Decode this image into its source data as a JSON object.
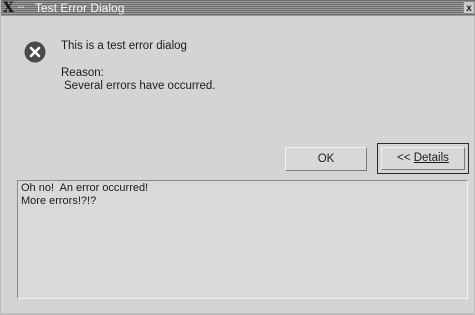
{
  "window": {
    "title": "Test Error Dialog",
    "close_glyph": "x",
    "menu_glyph": "--",
    "logo_glyph": "X"
  },
  "message": {
    "headline": "This is a test error dialog",
    "reason_label": "Reason:",
    "reason_text": "Several errors have occurred."
  },
  "buttons": {
    "ok_label": "OK",
    "details_prefix": "<< ",
    "details_label": "Details"
  },
  "details": {
    "lines": [
      "Oh no!  An error occurred!",
      "More errors!?!?"
    ]
  },
  "icons": {
    "error": "error-x-circle-icon"
  },
  "colors": {
    "titlebar_dark": "#6d6d6d",
    "titlebar_light": "#9a9a9a",
    "dialog_bg": "#d4d4d4",
    "error_icon_bg": "#4a4a4a"
  }
}
